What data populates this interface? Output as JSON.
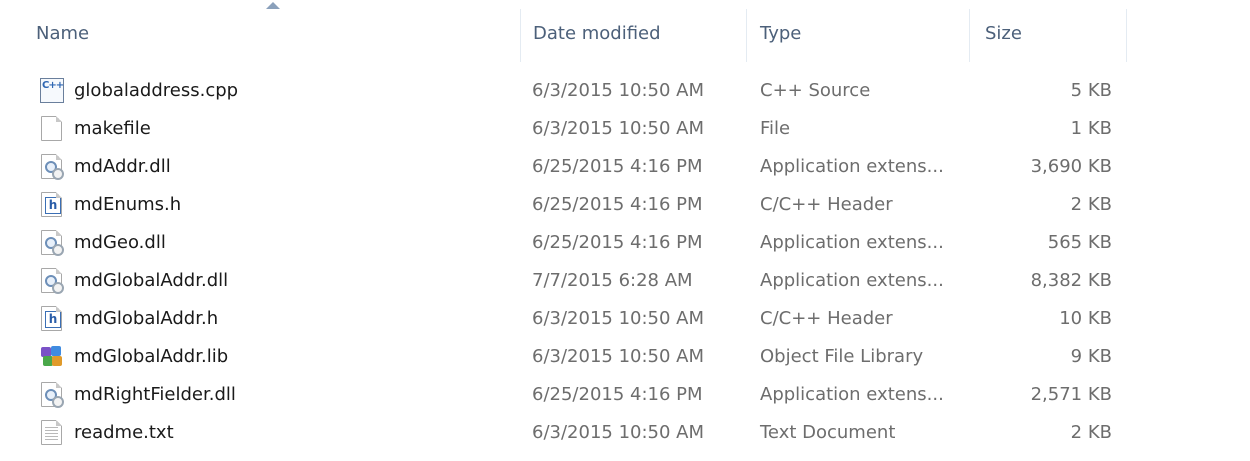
{
  "columns": {
    "name": "Name",
    "date": "Date modified",
    "type": "Type",
    "size": "Size"
  },
  "files": [
    {
      "name": "globaladdress.cpp",
      "date": "6/3/2015 10:50 AM",
      "type": "C++ Source",
      "size": "5 KB",
      "icon": "cpp-source-icon"
    },
    {
      "name": "makefile",
      "date": "6/3/2015 10:50 AM",
      "type": "File",
      "size": "1 KB",
      "icon": "blank-file-icon"
    },
    {
      "name": "mdAddr.dll",
      "date": "6/25/2015 4:16 PM",
      "type": "Application extens...",
      "size": "3,690 KB",
      "icon": "dll-file-icon"
    },
    {
      "name": "mdEnums.h",
      "date": "6/25/2015 4:16 PM",
      "type": "C/C++ Header",
      "size": "2 KB",
      "icon": "header-file-icon"
    },
    {
      "name": "mdGeo.dll",
      "date": "6/25/2015 4:16 PM",
      "type": "Application extens...",
      "size": "565 KB",
      "icon": "dll-file-icon"
    },
    {
      "name": "mdGlobalAddr.dll",
      "date": "7/7/2015 6:28 AM",
      "type": "Application extens...",
      "size": "8,382 KB",
      "icon": "dll-file-icon"
    },
    {
      "name": "mdGlobalAddr.h",
      "date": "6/3/2015 10:50 AM",
      "type": "C/C++ Header",
      "size": "10 KB",
      "icon": "header-file-icon"
    },
    {
      "name": "mdGlobalAddr.lib",
      "date": "6/3/2015 10:50 AM",
      "type": "Object File Library",
      "size": "9 KB",
      "icon": "library-file-icon"
    },
    {
      "name": "mdRightFielder.dll",
      "date": "6/25/2015 4:16 PM",
      "type": "Application extens...",
      "size": "2,571 KB",
      "icon": "dll-file-icon"
    },
    {
      "name": "readme.txt",
      "date": "6/3/2015 10:50 AM",
      "type": "Text Document",
      "size": "2 KB",
      "icon": "text-file-icon"
    }
  ],
  "colors": {
    "header_text": "#4c607a",
    "detail_text": "#6d6d6d",
    "name_text": "#1a1a1a"
  }
}
